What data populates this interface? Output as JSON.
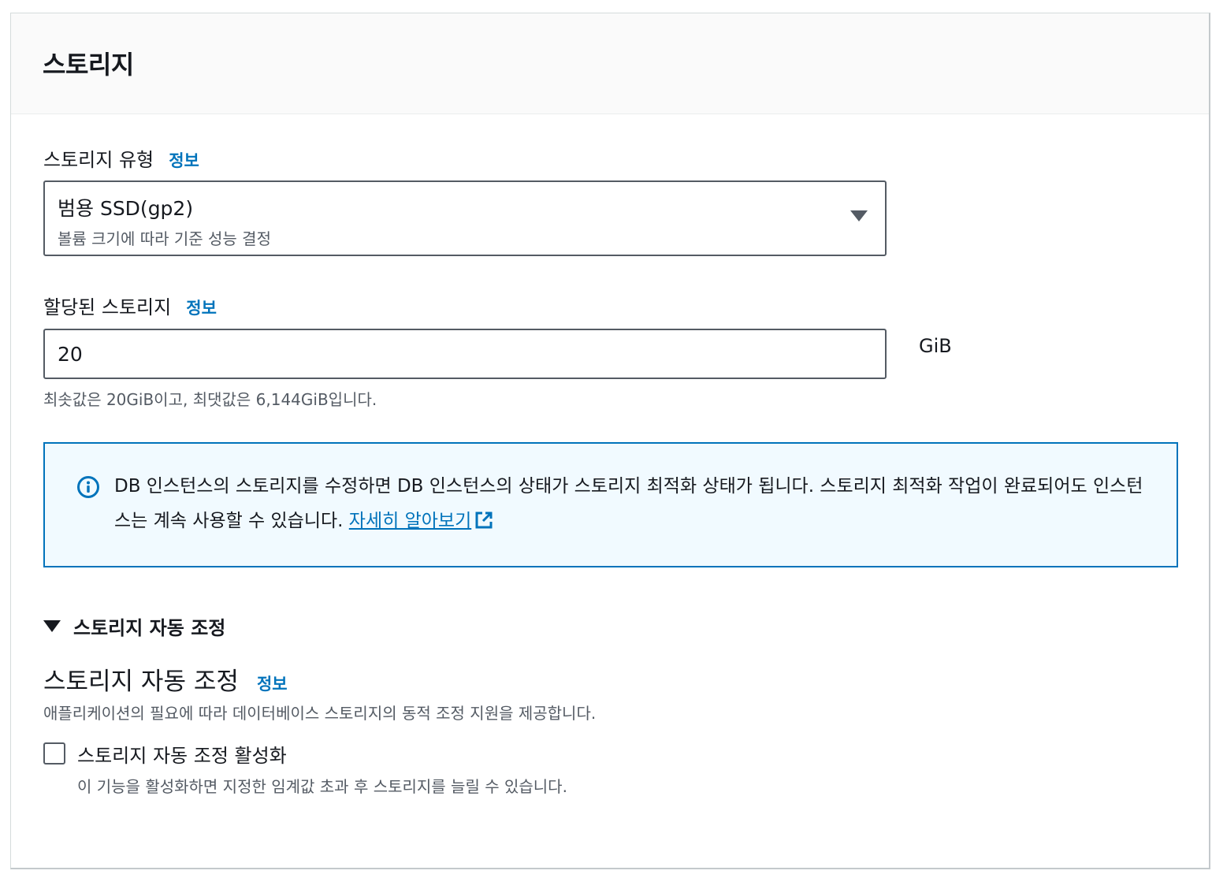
{
  "panel": {
    "title": "스토리지"
  },
  "storage_type": {
    "label": "스토리지 유형",
    "info_link": "정보",
    "selected_value": "범용 SSD(gp2)",
    "selected_description": "볼륨 크기에 따라 기준 성능 결정"
  },
  "allocated_storage": {
    "label": "할당된 스토리지",
    "info_link": "정보",
    "value": "20",
    "unit": "GiB",
    "constraint_hint": "최솟값은 20GiB이고, 최댓값은 6,144GiB입니다."
  },
  "alert": {
    "icon": "info-icon",
    "message": "DB 인스턴스의 스토리지를 수정하면 DB 인스턴스의 상태가 스토리지 최적화 상태가 됩니다. 스토리지 최적화 작업이 완료되어도 인스턴스는 계속 사용할 수 있습니다. ",
    "link_text": "자세히 알아보기",
    "link_icon": "external-link-icon",
    "accent_color": "#0073bb",
    "background_color": "#f1faff"
  },
  "autoscaling": {
    "expander_label": "스토리지 자동 조정",
    "expanded": true,
    "section_title": "스토리지 자동 조정",
    "info_link": "정보",
    "description": "애플리케이션의 필요에 따라 데이터베이스 스토리지의 동적 조정 지원을 제공합니다.",
    "checkbox_label": "스토리지 자동 조정 활성화",
    "checkbox_checked": false,
    "checkbox_description": "이 기능을 활성화하면 지정한 임계값 초과 후 스토리지를 늘릴 수 있습니다."
  },
  "colors": {
    "link": "#0073bb",
    "text": "#16191f",
    "secondary_text": "#545b64",
    "header_background": "#fafafa"
  }
}
